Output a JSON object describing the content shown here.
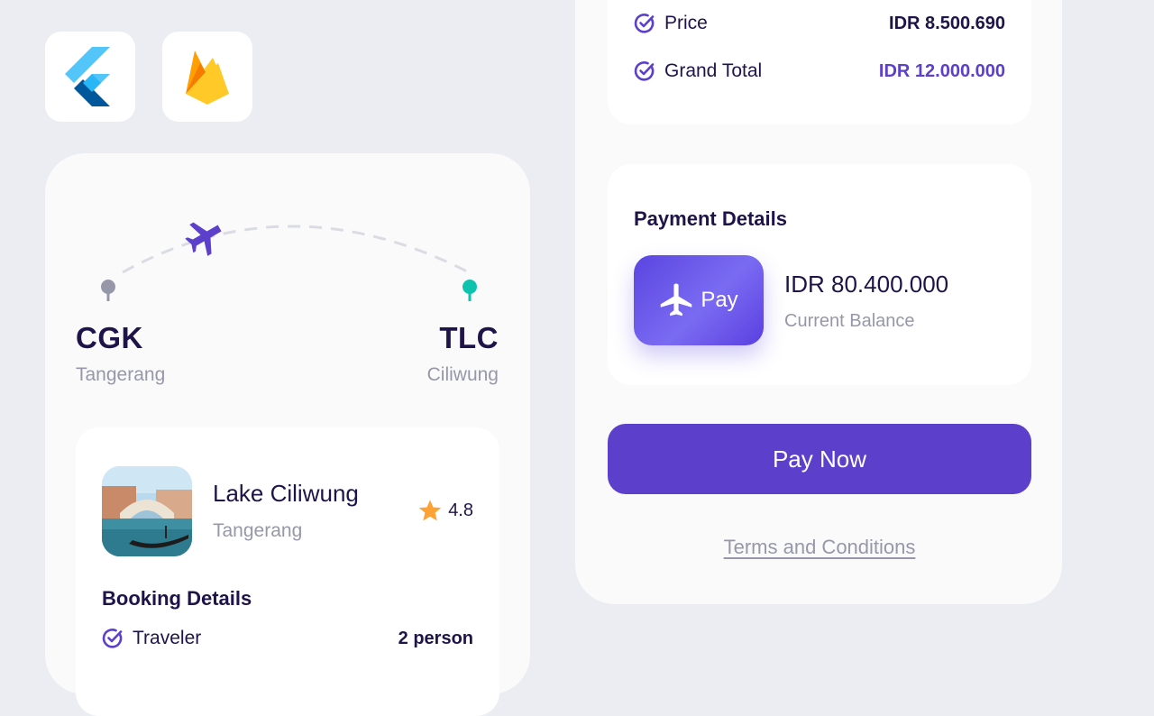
{
  "logos": {
    "flutter": "flutter-logo",
    "firebase": "firebase-logo"
  },
  "route": {
    "origin": {
      "code": "CGK",
      "city": "Tangerang"
    },
    "destination": {
      "code": "TLC",
      "city": "Ciliwung"
    }
  },
  "destination_card": {
    "name": "Lake Ciliwung",
    "city": "Tangerang",
    "rating": "4.8"
  },
  "booking": {
    "title": "Booking Details",
    "rows": [
      {
        "label": "Traveler",
        "value": "2 person"
      }
    ]
  },
  "summary": {
    "rows": [
      {
        "label": "Price",
        "value": "IDR 8.500.690"
      },
      {
        "label": "Grand Total",
        "value": "IDR 12.000.000"
      }
    ]
  },
  "payment": {
    "title": "Payment Details",
    "method_label": "Pay",
    "balance": "IDR 80.400.000",
    "balance_label": "Current Balance"
  },
  "actions": {
    "pay_now": "Pay Now",
    "terms": "Terms and Conditions"
  },
  "colors": {
    "primary": "#5C40CC",
    "text": "#1F1449",
    "muted": "#9698A9",
    "accent_green": "#0EC3AE",
    "star": "#FFA235",
    "background": "#ECEDF2"
  }
}
